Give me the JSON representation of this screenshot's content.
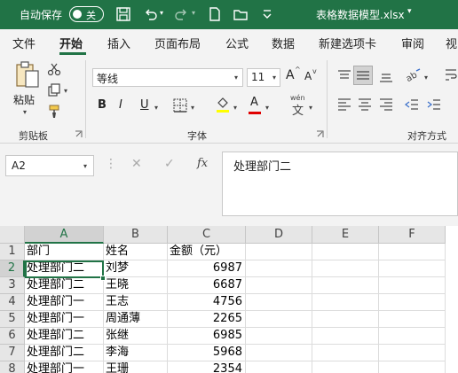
{
  "titlebar": {
    "autosave_label": "自动保存",
    "autosave_state": "关",
    "file_title": "表格数据模型.xlsx",
    "caret": "▾"
  },
  "tabs": [
    "文件",
    "开始",
    "插入",
    "页面布局",
    "公式",
    "数据",
    "新建选项卡",
    "审阅",
    "视"
  ],
  "active_tab": "开始",
  "ribbon": {
    "clipboard": {
      "paste_label": "粘贴",
      "group_label": "剪贴板"
    },
    "font": {
      "font_name": "等线",
      "font_size": "11",
      "grow_label": "A",
      "shrink_label": "A",
      "bold": "B",
      "italic": "I",
      "underline": "U",
      "font_color_letter": "A",
      "phonetic_label": "wén",
      "group_label": "字体",
      "highlight_color": "#ffff00",
      "font_color": "#e00000"
    },
    "alignment": {
      "group_label": "对齐方式"
    }
  },
  "formula_bar": {
    "name_box": "A2",
    "fx": "fx",
    "content": "处理部门二"
  },
  "grid": {
    "columns": [
      "A",
      "B",
      "C",
      "D",
      "E",
      "F"
    ],
    "rows": [
      {
        "n": "1",
        "a": "部门",
        "b": "姓名",
        "c": "金额（元）"
      },
      {
        "n": "2",
        "a": "处理部门二",
        "b": "刘梦",
        "c": "6987"
      },
      {
        "n": "3",
        "a": "处理部门二",
        "b": "王晓",
        "c": "6687"
      },
      {
        "n": "4",
        "a": "处理部门一",
        "b": "王志",
        "c": "4756"
      },
      {
        "n": "5",
        "a": "处理部门一",
        "b": "周通薄",
        "c": "2265"
      },
      {
        "n": "6",
        "a": "处理部门二",
        "b": "张继",
        "c": "6985"
      },
      {
        "n": "7",
        "a": "处理部门二",
        "b": "李海",
        "c": "5968"
      },
      {
        "n": "8",
        "a": "处理部门一",
        "b": "王珊",
        "c": "2354"
      }
    ],
    "selected_cell": "A2"
  },
  "colors": {
    "brand": "#217346",
    "header_bg": "#e6e6e6"
  }
}
